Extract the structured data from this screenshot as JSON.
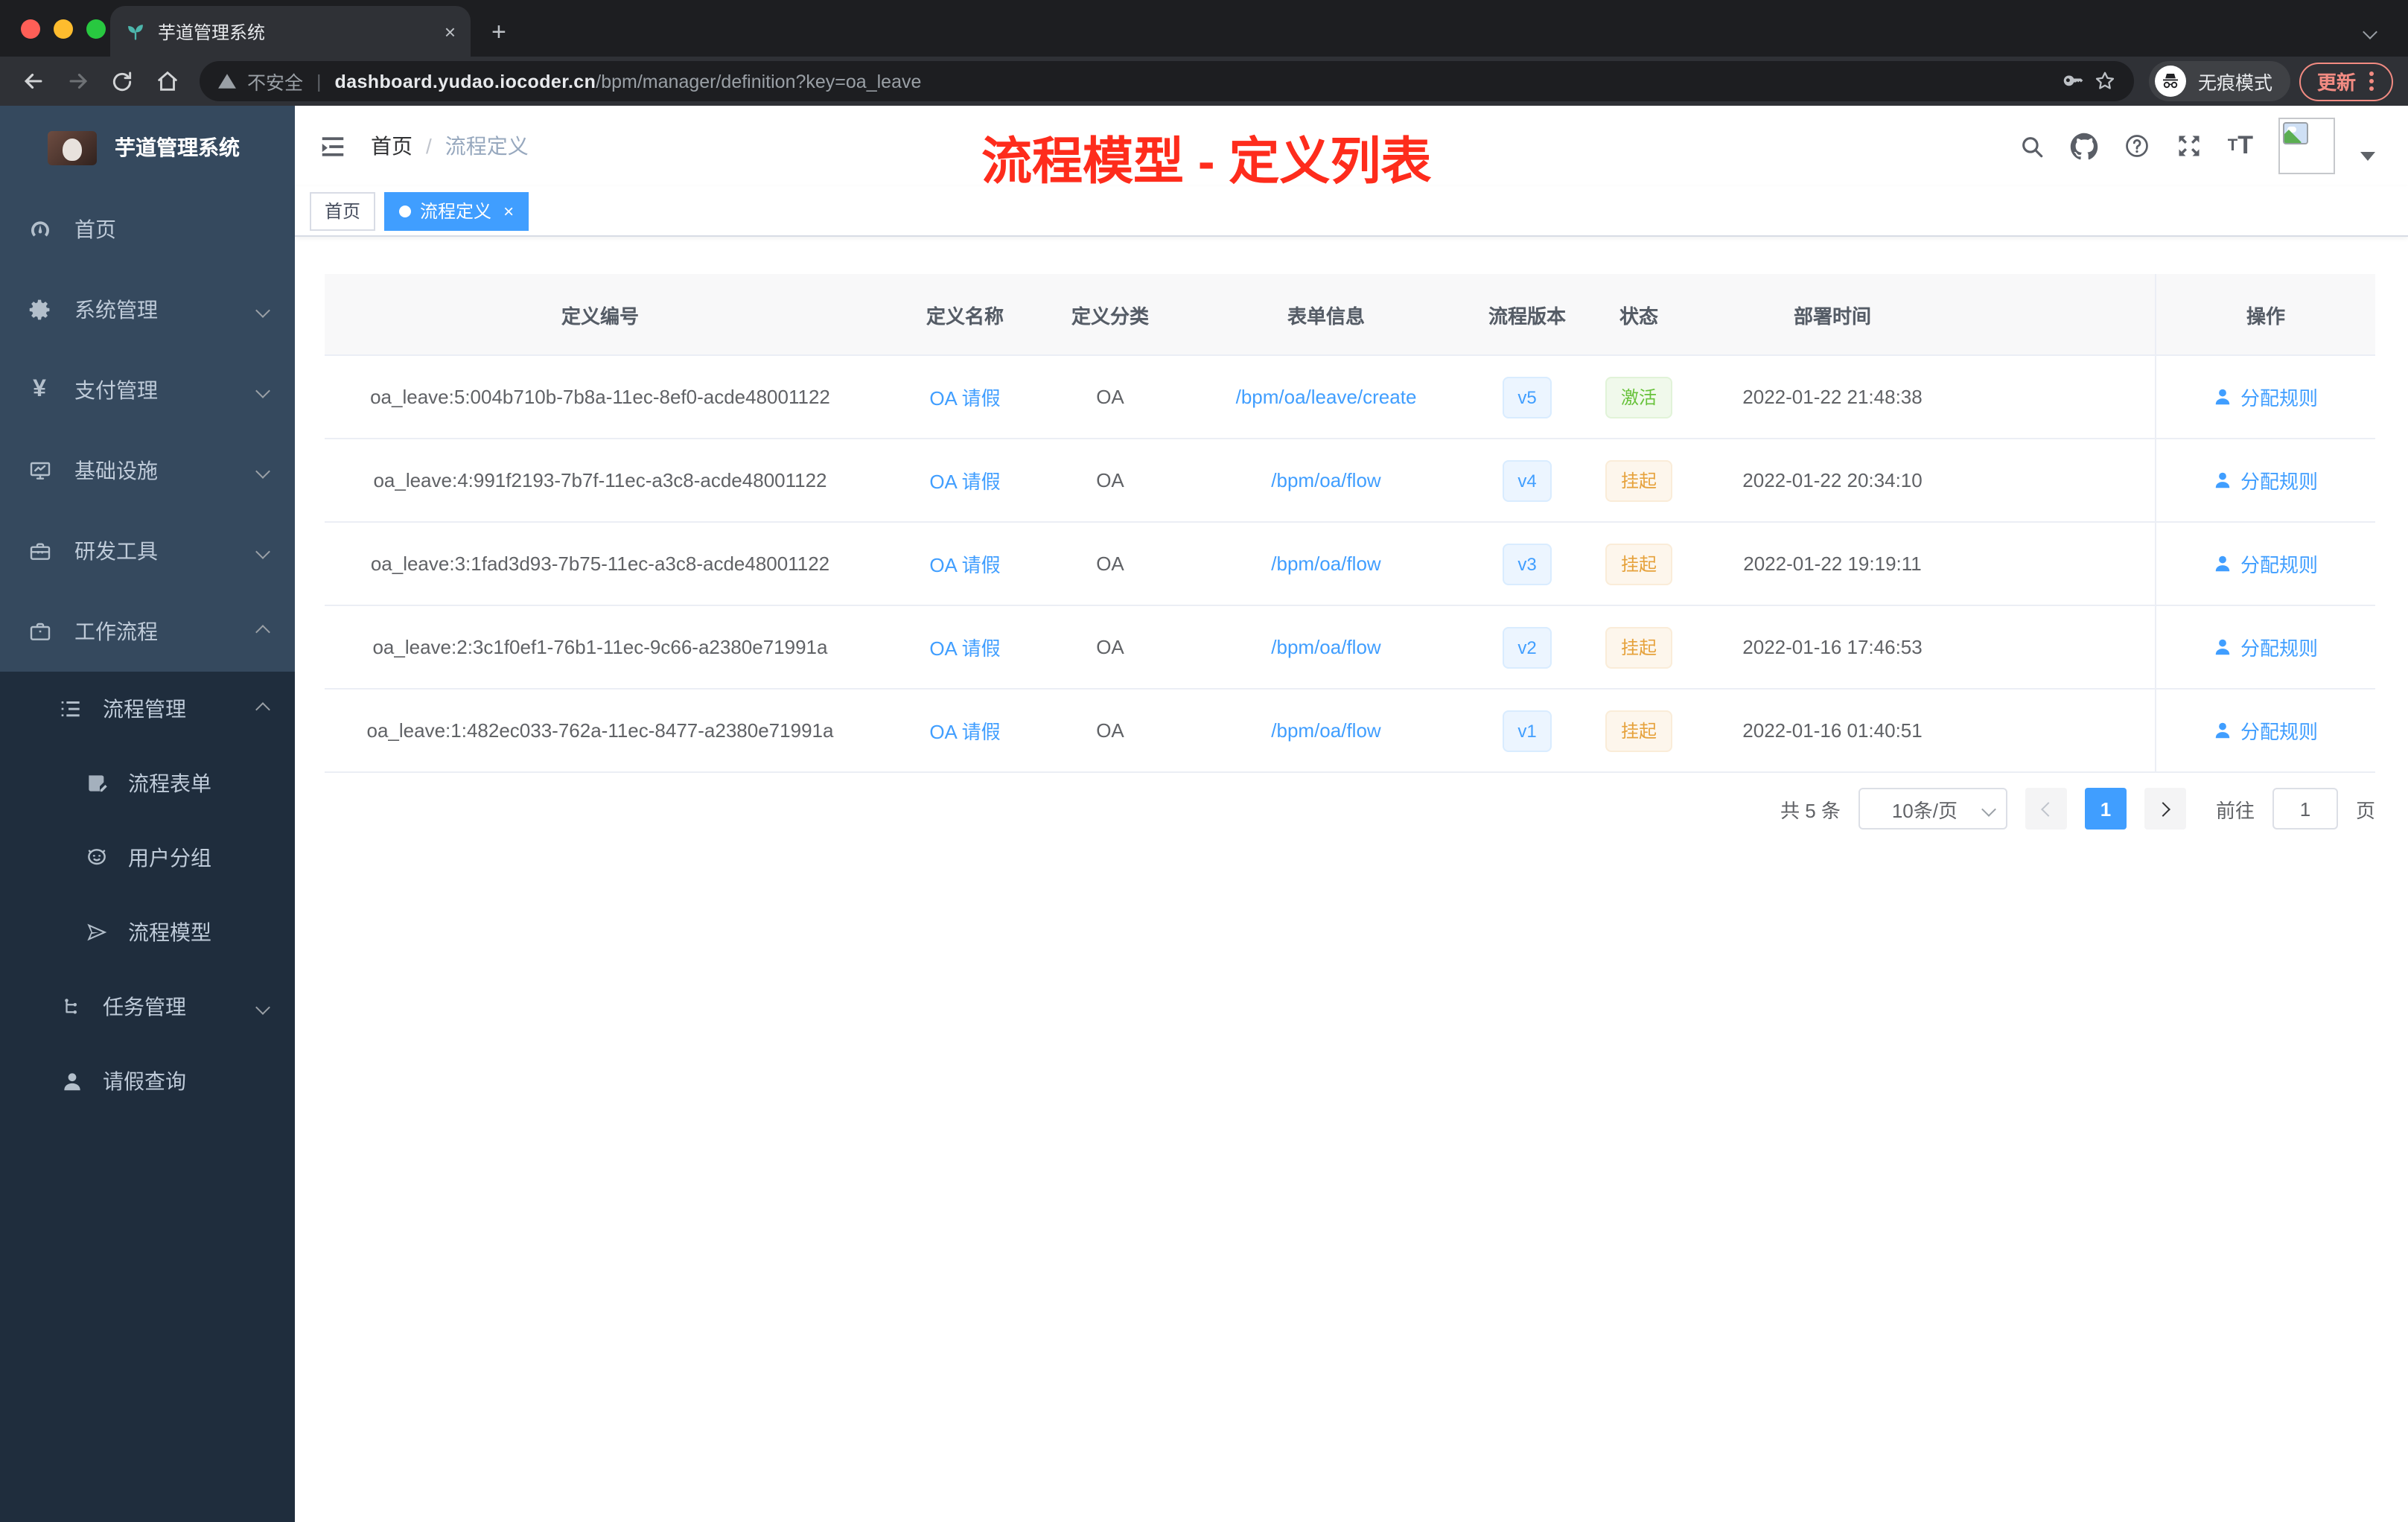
{
  "colors": {
    "accent": "#409eff",
    "success": "#67c23a",
    "warning": "#e6a23c",
    "annotation_red": "#fe2c1c",
    "sidebar_bg": "#35495e",
    "submenu_bg": "#1f2d3d",
    "active_tag_bg": "#409eff"
  },
  "browser": {
    "tab_title": "芋道管理系统",
    "close_glyph": "×",
    "newtab_glyph": "+",
    "security_label": "不安全",
    "url_host": "dashboard.yudao.iocoder.cn",
    "url_path": "/bpm/manager/definition?key=oa_leave",
    "incognito_label": "无痕模式",
    "update_label": "更新"
  },
  "sidebar": {
    "logo_title": "芋道管理系统",
    "items": [
      {
        "label": "首页",
        "icon": "dashboard-icon"
      },
      {
        "label": "系统管理",
        "icon": "gear-icon",
        "chevron": "down"
      },
      {
        "label": "支付管理",
        "icon": "yen-icon",
        "glyph": "¥",
        "chevron": "down"
      },
      {
        "label": "基础设施",
        "icon": "monitor-icon",
        "chevron": "down"
      },
      {
        "label": "研发工具",
        "icon": "toolbox-icon",
        "chevron": "down"
      },
      {
        "label": "工作流程",
        "icon": "briefcase-icon",
        "chevron": "up"
      }
    ],
    "submenu": {
      "group_label": "流程管理",
      "group_chevron": "up",
      "children": [
        {
          "label": "流程表单",
          "icon": "form-icon"
        },
        {
          "label": "用户分组",
          "icon": "people-icon"
        },
        {
          "label": "流程模型",
          "icon": "send-icon"
        }
      ],
      "task_label": "任务管理",
      "task_chevron": "down",
      "leave_label": "请假查询"
    }
  },
  "header": {
    "breadcrumb_home": "首页",
    "breadcrumb_sep": "/",
    "breadcrumb_current": "流程定义",
    "annotation": "流程模型 - 定义列表"
  },
  "tags": {
    "home_label": "首页",
    "active_label": "流程定义",
    "active_close_glyph": "×"
  },
  "table": {
    "columns": [
      "定义编号",
      "定义名称",
      "定义分类",
      "表单信息",
      "流程版本",
      "状态",
      "部署时间",
      "操作"
    ],
    "action_label": "分配规则",
    "rows": [
      {
        "id": "oa_leave:5:004b710b-7b8a-11ec-8ef0-acde48001122",
        "name": "OA 请假",
        "category": "OA",
        "form": "/bpm/oa/leave/create",
        "version": "v5",
        "status": "激活",
        "status_type": "success",
        "deploy_time": "2022-01-22 21:48:38"
      },
      {
        "id": "oa_leave:4:991f2193-7b7f-11ec-a3c8-acde48001122",
        "name": "OA 请假",
        "category": "OA",
        "form": "/bpm/oa/flow",
        "version": "v4",
        "status": "挂起",
        "status_type": "warning",
        "deploy_time": "2022-01-22 20:34:10"
      },
      {
        "id": "oa_leave:3:1fad3d93-7b75-11ec-a3c8-acde48001122",
        "name": "OA 请假",
        "category": "OA",
        "form": "/bpm/oa/flow",
        "version": "v3",
        "status": "挂起",
        "status_type": "warning",
        "deploy_time": "2022-01-22 19:19:11"
      },
      {
        "id": "oa_leave:2:3c1f0ef1-76b1-11ec-9c66-a2380e71991a",
        "name": "OA 请假",
        "category": "OA",
        "form": "/bpm/oa/flow",
        "version": "v2",
        "status": "挂起",
        "status_type": "warning",
        "deploy_time": "2022-01-16 17:46:53"
      },
      {
        "id": "oa_leave:1:482ec033-762a-11ec-8477-a2380e71991a",
        "name": "OA 请假",
        "category": "OA",
        "form": "/bpm/oa/flow",
        "version": "v1",
        "status": "挂起",
        "status_type": "warning",
        "deploy_time": "2022-01-16 01:40:51"
      }
    ]
  },
  "pagination": {
    "total_label": "共 5 条",
    "page_size_label": "10条/页",
    "current_page": "1",
    "goto_label": "前往",
    "goto_value": "1",
    "page_suffix_label": "页"
  }
}
